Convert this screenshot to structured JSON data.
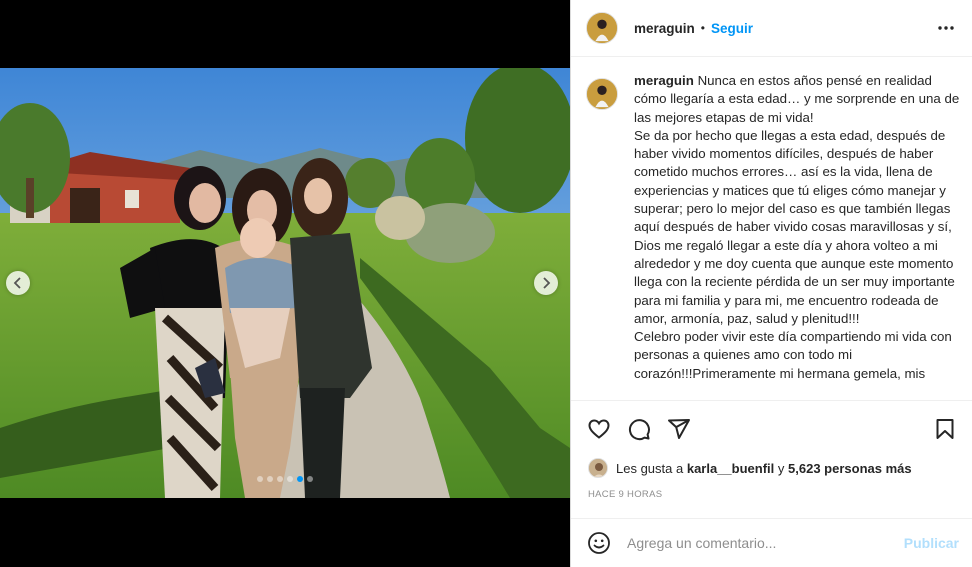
{
  "header": {
    "username": "meraguin",
    "separator": "•",
    "follow_label": "Seguir"
  },
  "caption": {
    "username": "meraguin",
    "paragraphs": [
      "Nunca en estos años pensé en realidad cómo llegaría a esta edad… y me sorprende en una de las mejores etapas de mi vida!",
      "Se da por hecho que llegas a esta edad, después de haber vivido momentos difíciles, después de haber cometido muchos errores… así es la vida, llena de experiencias y matices que tú eliges cómo manejar y superar; pero lo mejor del caso es que también llegas aquí después de haber vivido cosas maravillosas y sí, Dios me regaló llegar a este día y ahora volteo a mi alrededor y me doy cuenta que aunque este momento llega con la reciente pérdida de un ser muy importante para mi familia y para mi, me encuentro rodeada de amor, armonía, paz, salud y plenitud!!!",
      "Celebro poder vivir este día compartiendo mi vida con personas a quienes amo con todo mi corazón!!!Primeramente mi hermana gemela, mis"
    ]
  },
  "likes": {
    "prefix": "Les gusta a",
    "user": "karla__buenfil",
    "middle": "y",
    "count": "5,623 personas más"
  },
  "time_ago": "HACE 9 HORAS",
  "comment": {
    "placeholder": "Agrega un comentario...",
    "publish_label": "Publicar"
  },
  "carousel": {
    "total_slides": 6,
    "current_slide": 5
  },
  "colors": {
    "accent": "#0095f6",
    "publish_disabled": "#b2dffc",
    "muted": "#8e8e8e"
  }
}
